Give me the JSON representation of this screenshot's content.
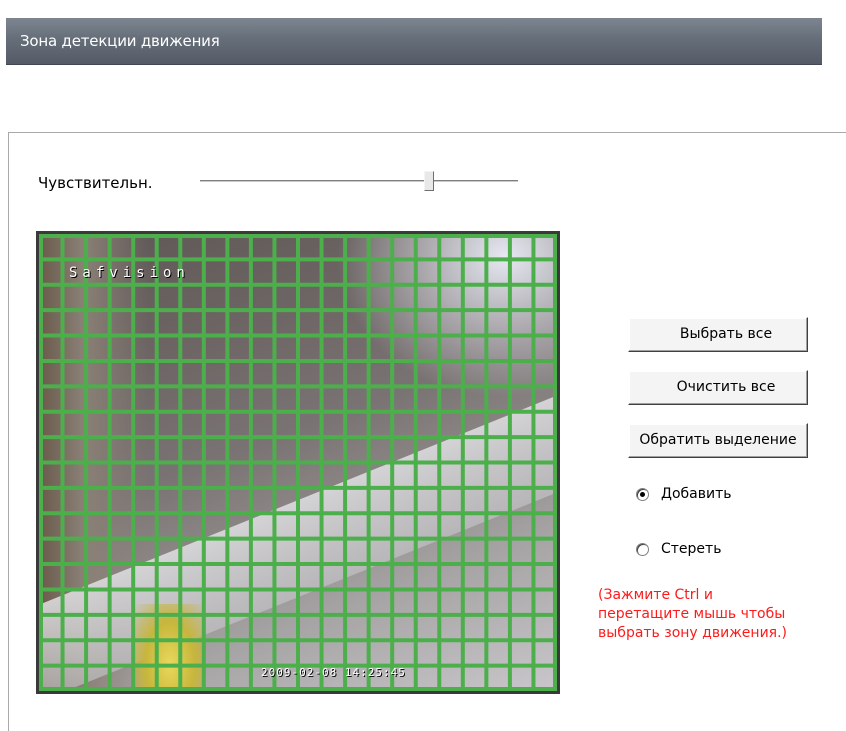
{
  "window": {
    "title": "Зона детекции движения"
  },
  "sensitivity": {
    "label": "Чувствительн.",
    "value_fraction": 0.72
  },
  "video": {
    "osd_name": "Safvision",
    "osd_timestamp": "2009-02-08  14:25:45",
    "grid_cols": 22,
    "grid_rows": 18,
    "grid_color": "#4caf4c"
  },
  "actions": {
    "select_all": "Выбрать все",
    "clear_all": "Очистить все",
    "invert_selection": "Обратить выделение"
  },
  "mode": {
    "add_label": "Добавить",
    "erase_label": "Стереть",
    "selected": "add"
  },
  "hint": {
    "lines": [
      "(Зажмите Ctrl и",
      "перетащите мышь чтобы",
      "выбрать зону движения.)"
    ],
    "color": "#ff1a1a"
  }
}
